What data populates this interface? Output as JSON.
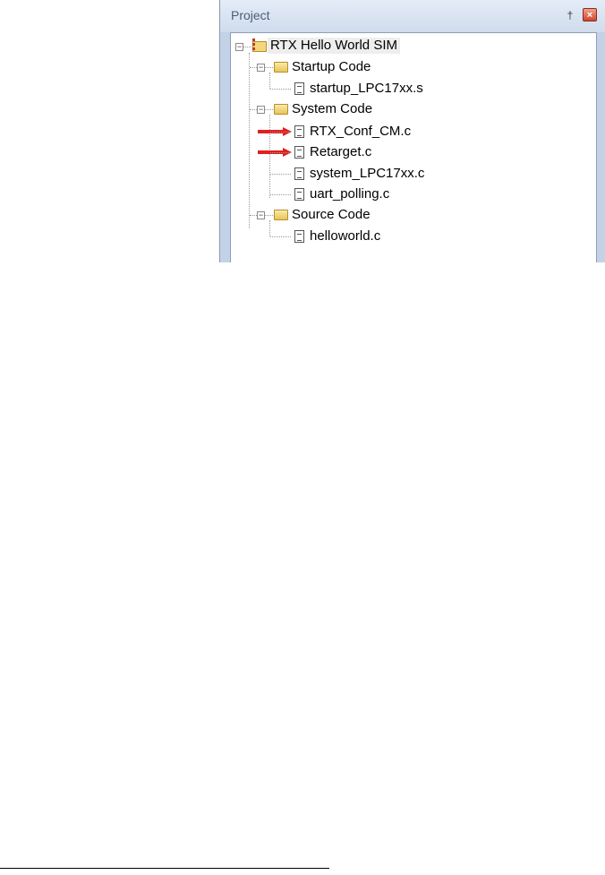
{
  "panel": {
    "title": "Project",
    "pin_glyph": "†",
    "close_glyph": "×"
  },
  "tree": {
    "root": {
      "label": "RTX Hello World SIM",
      "icon": "project-icon",
      "expanded": true
    },
    "groups": [
      {
        "label": "Startup Code",
        "icon": "folder-icon",
        "expanded": true,
        "files": [
          {
            "label": "startup_LPC17xx.s",
            "icon": "file-icon",
            "marked": false
          }
        ]
      },
      {
        "label": "System Code",
        "icon": "folder-icon",
        "expanded": true,
        "files": [
          {
            "label": "RTX_Conf_CM.c",
            "icon": "file-icon",
            "marked": true
          },
          {
            "label": "Retarget.c",
            "icon": "file-icon",
            "marked": true
          },
          {
            "label": "system_LPC17xx.c",
            "icon": "file-icon",
            "marked": false
          },
          {
            "label": "uart_polling.c",
            "icon": "file-icon",
            "marked": false
          }
        ]
      },
      {
        "label": "Source Code",
        "icon": "folder-icon",
        "expanded": true,
        "files": [
          {
            "label": "helloworld.c",
            "icon": "file-icon",
            "marked": false
          }
        ]
      }
    ]
  },
  "colors": {
    "panel_border": "#8b99aa",
    "arrow": "#e02020",
    "folder": "#f4d77a"
  },
  "expander_glyph": "−"
}
